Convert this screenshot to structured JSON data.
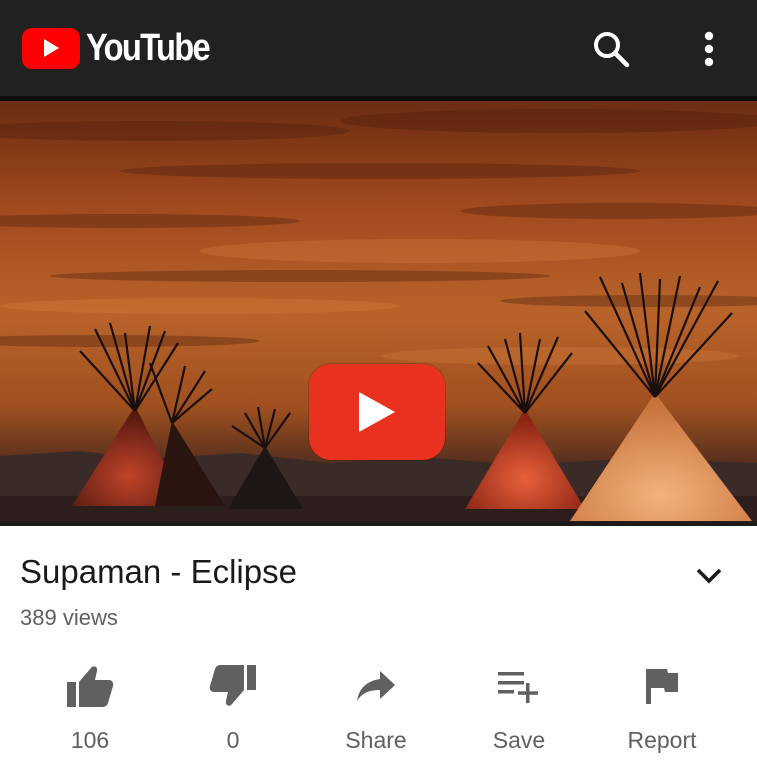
{
  "header": {
    "app_name": "YouTube",
    "logo_color": "#ff0000",
    "background": "#212121",
    "icons": [
      "search-icon",
      "more-vert-icon"
    ]
  },
  "video": {
    "title": "Supaman - Eclipse",
    "views": "389 views",
    "play_button_color": "#e8311f"
  },
  "actions": [
    {
      "icon": "thumb-up-icon",
      "label": "106"
    },
    {
      "icon": "thumb-down-icon",
      "label": "0"
    },
    {
      "icon": "share-icon",
      "label": "Share"
    },
    {
      "icon": "playlist-add-icon",
      "label": "Save"
    },
    {
      "icon": "flag-icon",
      "label": "Report"
    }
  ]
}
